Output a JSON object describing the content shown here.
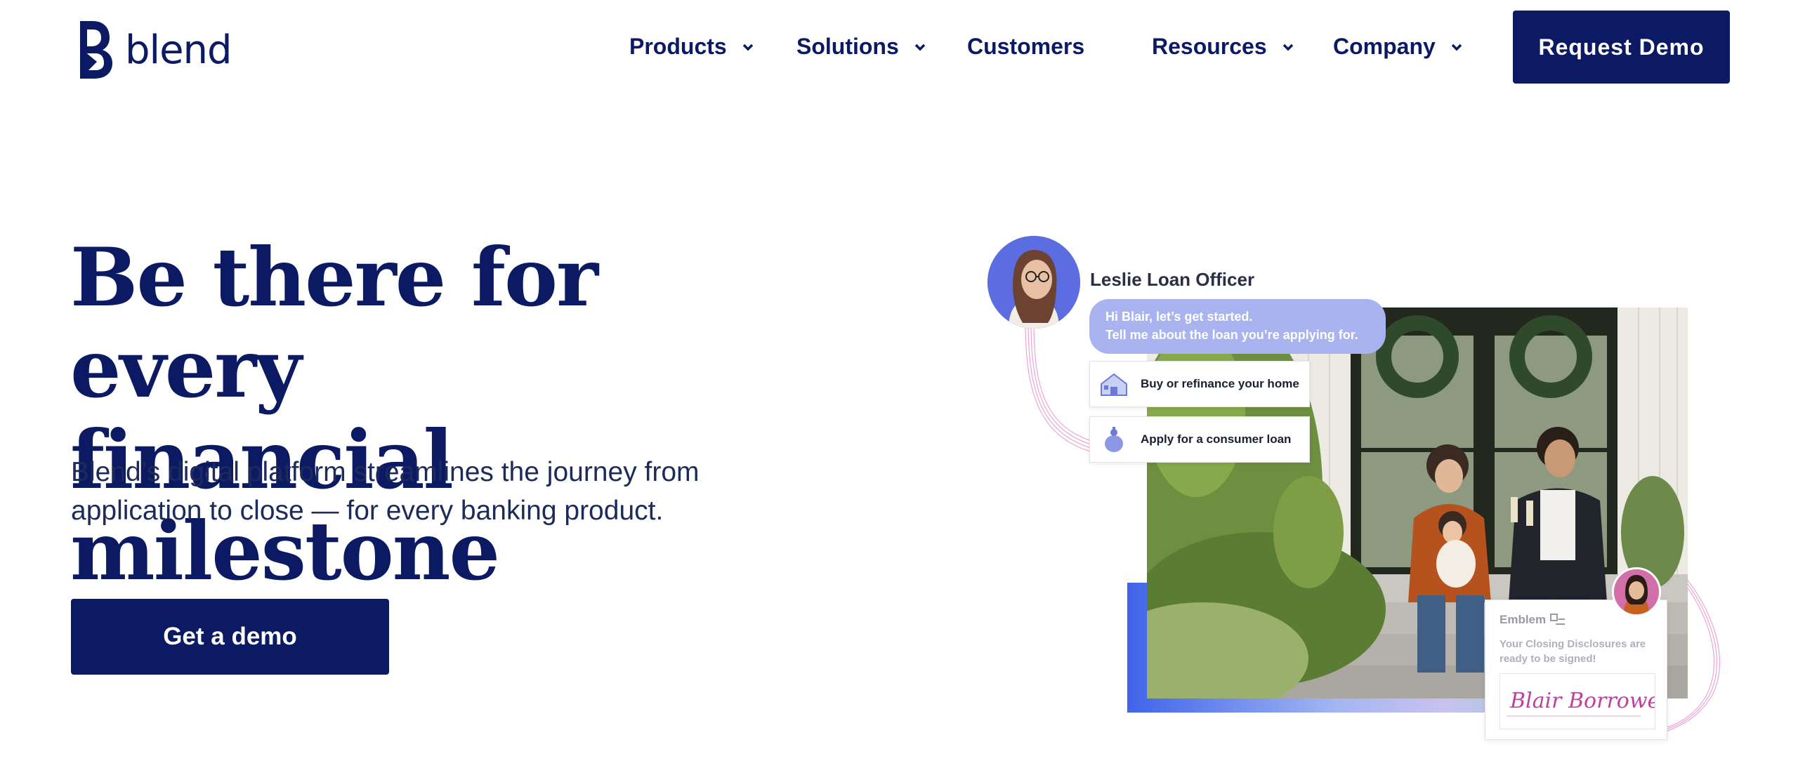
{
  "header": {
    "logo_text": "blend",
    "nav": [
      {
        "label": "Products",
        "has_dropdown": true
      },
      {
        "label": "Solutions",
        "has_dropdown": true
      },
      {
        "label": "Customers",
        "has_dropdown": false
      },
      {
        "label": "Resources",
        "has_dropdown": true
      },
      {
        "label": "Company",
        "has_dropdown": true
      }
    ],
    "cta_label": "Request Demo"
  },
  "hero": {
    "headline_line1": "Be there for every",
    "headline_line2": "financial milestone",
    "subtext_line1": "Blend’s digital platform streamlines the journey from",
    "subtext_line2": "application to close — for every banking product.",
    "cta_label": "Get a demo"
  },
  "illustration": {
    "agent_name": "Leslie Loan Officer",
    "bubble_line1": "Hi Blair, let’s get started.",
    "bubble_line2": "Tell me about the loan you’re applying for.",
    "options": [
      {
        "label": "Buy or refinance your home",
        "icon": "house-icon"
      },
      {
        "label": "Apply for a consumer loan",
        "icon": "piggy-bank-icon"
      }
    ],
    "sign_card": {
      "brand": "Emblem",
      "message": "Your Closing Disclosures are ready to be signed!",
      "signature": "Blair Borrower"
    }
  },
  "colors": {
    "brand_navy": "#0b1a63",
    "bubble_lavender": "#a8b3f0",
    "avatar_blue": "#5b6de0"
  }
}
